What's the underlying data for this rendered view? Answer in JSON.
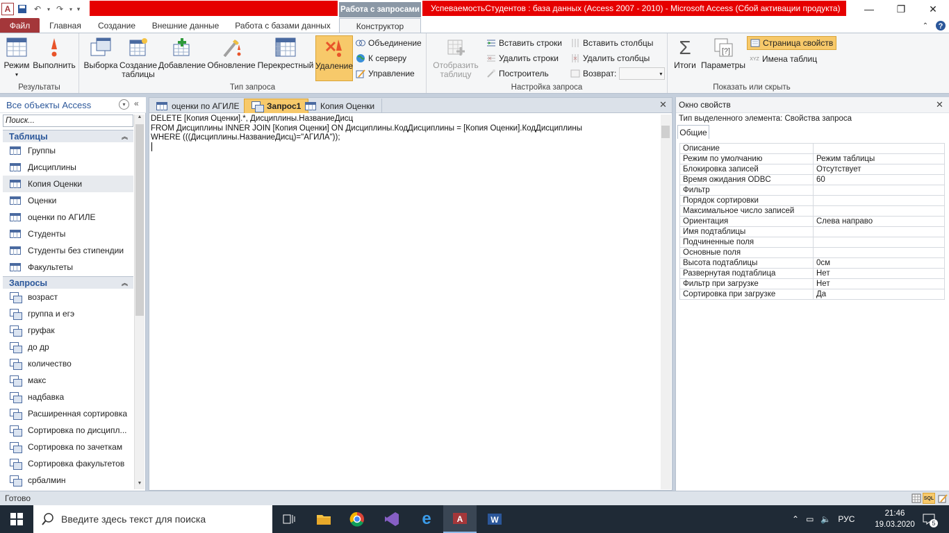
{
  "title_bar": {
    "context_tab": "Работа с запросами",
    "window_title": "УспеваемостьСтудентов : база данных (Access 2007 - 2010)  -  Microsoft Access (Сбой активации продукта)",
    "app_logo": "A"
  },
  "ribbon_tabs": [
    "Файл",
    "Главная",
    "Создание",
    "Внешние данные",
    "Работа с базами данных",
    "Конструктор"
  ],
  "ribbon": {
    "results": {
      "label": "Результаты",
      "mode": "Режим",
      "run": "Выполнить"
    },
    "query_type": {
      "label": "Тип запроса",
      "select": "Выборка",
      "make_table_1": "Создание",
      "make_table_2": "таблицы",
      "append": "Добавление",
      "update": "Обновление",
      "crosstab": "Перекрестный",
      "delete": "Удаление",
      "union": "Объединение",
      "pass_through": "К серверу",
      "data_def": "Управление"
    },
    "query_setup": {
      "label": "Настройка запроса",
      "show_table_1": "Отобразить",
      "show_table_2": "таблицу",
      "insert_rows": "Вставить строки",
      "delete_rows": "Удалить строки",
      "builder": "Построитель",
      "insert_cols": "Вставить столбцы",
      "delete_cols": "Удалить столбцы",
      "return": "Возврат:"
    },
    "show_hide": {
      "label": "Показать или скрыть",
      "totals": "Итоги",
      "params": "Параметры",
      "property_sheet": "Страница свойств",
      "table_names": "Имена таблиц"
    }
  },
  "nav": {
    "header": "Все объекты Access",
    "search_placeholder": "Поиск...",
    "tables_header": "Таблицы",
    "tables": [
      "Группы",
      "Дисциплины",
      "Копия Оценки",
      "Оценки",
      "оценки по АГИЛЕ",
      "Студенты",
      "Студенты без стипендии",
      "Факультеты"
    ],
    "queries_header": "Запросы",
    "queries": [
      "возраст",
      "группа и егэ",
      "груфак",
      "до др",
      "количество",
      "макс",
      "надбавка",
      "Расширенная сортировка",
      "Сортировка по дисципл...",
      "Сортировка по зачеткам",
      "Сортировка факультетов",
      "србалмин"
    ]
  },
  "doc_tabs": [
    "оценки по АГИЛЕ",
    "Запрос1",
    "Копия Оценки"
  ],
  "sql": "DELETE [Копия Оценки].*, Дисциплины.НазваниеДисц\nFROM Дисциплины INNER JOIN [Копия Оценки] ON Дисциплины.КодДисциплины = [Копия Оценки].КодДисциплины\nWHERE (((Дисциплины.НазваниеДисц)=\"АГИЛА\"));",
  "props": {
    "header": "Окно свойств",
    "type_label": "Тип выделенного элемента:  Свойства запроса",
    "tab": "Общие",
    "rows": [
      [
        "Описание",
        ""
      ],
      [
        "Режим по умолчанию",
        "Режим таблицы"
      ],
      [
        "Блокировка записей",
        "Отсутствует"
      ],
      [
        "Время ожидания ODBC",
        "60"
      ],
      [
        "Фильтр",
        ""
      ],
      [
        "Порядок сортировки",
        ""
      ],
      [
        "Максимальное число записей",
        ""
      ],
      [
        "Ориентация",
        "Слева направо"
      ],
      [
        "Имя подтаблицы",
        ""
      ],
      [
        "Подчиненные поля",
        ""
      ],
      [
        "Основные поля",
        ""
      ],
      [
        "Высота подтаблицы",
        "0см"
      ],
      [
        "Развернутая подтаблица",
        "Нет"
      ],
      [
        "Фильтр при загрузке",
        "Нет"
      ],
      [
        "Сортировка при загрузке",
        "Да"
      ]
    ]
  },
  "status": "Готово",
  "taskbar": {
    "search_placeholder": "Введите здесь текст для поиска",
    "lang": "РУС",
    "time": "21:46",
    "date": "19.03.2020",
    "notif": "5"
  },
  "colors": {
    "accent": "#a4373a",
    "highlight": "#f7c96a",
    "redbar": "#e60000"
  }
}
